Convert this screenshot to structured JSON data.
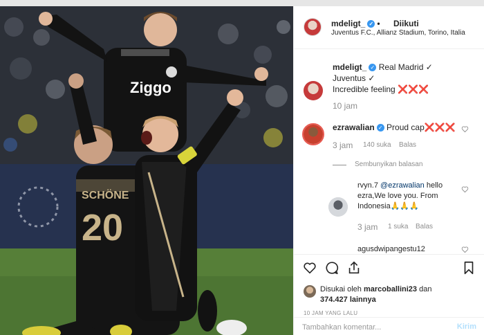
{
  "post": {
    "author": "mdeligt_",
    "follow_status": "Diikuti",
    "location": "Juventus F.C., Allianz Stadium, Torino, Italia",
    "jersey_sponsor": "Ziggo",
    "jersey_name": "SCHÖNE",
    "jersey_number": "20"
  },
  "caption": {
    "author": "mdeligt_",
    "line1": "Real Madrid ✓",
    "line2": "Juventus ✓",
    "line3": "Incredible feeling ❌❌❌",
    "time": "10 jam"
  },
  "comments": [
    {
      "author": "ezrawalian",
      "text": "Proud cap❌❌❌",
      "time": "3 jam",
      "likes": "140 suka",
      "reply_label": "Balas",
      "hide_replies": "Sembunyikan balasan"
    }
  ],
  "replies": [
    {
      "author": "rvyn.7",
      "mention": "@ezrawalian",
      "text_line1": "hello",
      "text_line2": "ezra,We love you. From",
      "text_line3": "Indonesia🙏🙏🙏",
      "time": "3 jam",
      "likes": "1 suka",
      "reply_label": "Balas"
    }
  ],
  "next_comment_author": "agusdwipangestu12",
  "liked_by": {
    "prefix": "Disukai oleh",
    "user": "marcoballini23",
    "joiner": "dan",
    "count": "374.427",
    "suffix": "lainnya"
  },
  "posted_ago": "10 JAM YANG LALU",
  "comment_input": {
    "placeholder": "Tambahkan komentar...",
    "send_label": "Kirim"
  },
  "icons": [
    "heart-icon",
    "comment-icon",
    "share-icon",
    "bookmark-icon",
    "verified-badge-icon"
  ],
  "colors": {
    "verified": "#3897f0",
    "text": "#262626",
    "muted": "#8e8e8e",
    "send_disabled": "#b2dffc",
    "mention": "#003569"
  }
}
